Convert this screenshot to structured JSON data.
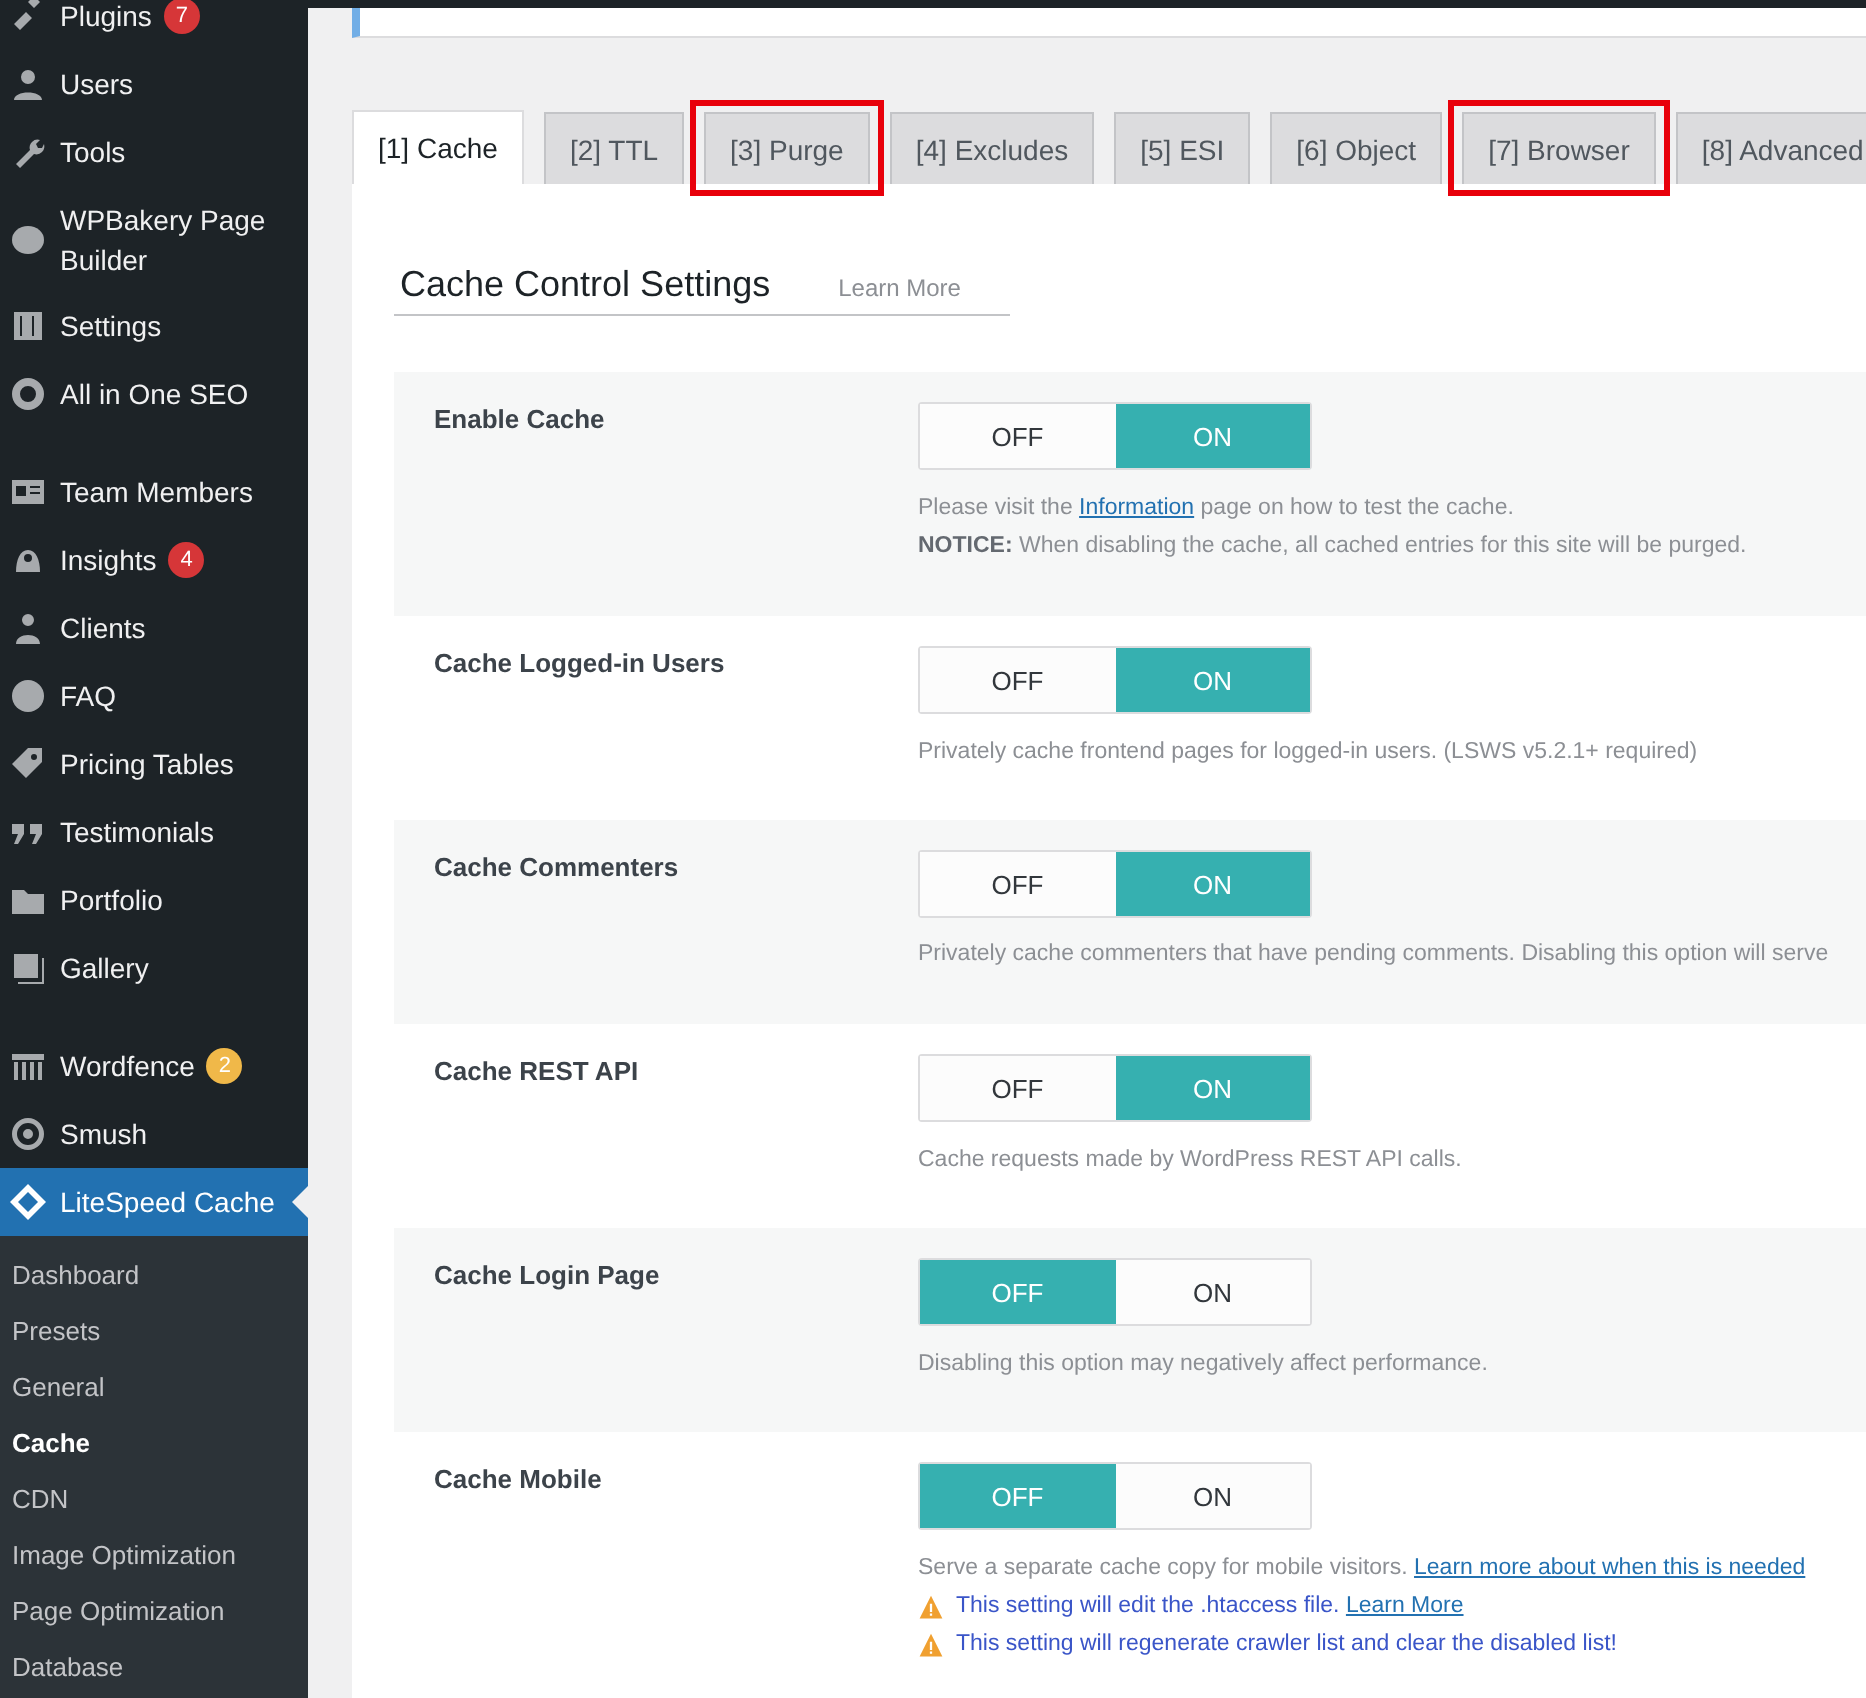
{
  "sidebar": {
    "items": [
      {
        "label": "Plugins",
        "badge": "7",
        "color": "#d63638",
        "gap_before": false
      },
      {
        "label": "Users",
        "gap_before": false
      },
      {
        "label": "Tools",
        "gap_before": false
      },
      {
        "label": "WPBakery Page Builder",
        "gap_before": false
      },
      {
        "label": "Settings",
        "gap_before": false
      },
      {
        "label": "All in One SEO",
        "gap_before": false
      },
      {
        "label": "Team Members",
        "gap_before": true
      },
      {
        "label": "Insights",
        "badge": "4",
        "color": "#d63638",
        "gap_before": false
      },
      {
        "label": "Clients",
        "gap_before": false
      },
      {
        "label": "FAQ",
        "gap_before": false
      },
      {
        "label": "Pricing Tables",
        "gap_before": false
      },
      {
        "label": "Testimonials",
        "gap_before": false
      },
      {
        "label": "Portfolio",
        "gap_before": false
      },
      {
        "label": "Gallery",
        "gap_before": false
      },
      {
        "label": "Wordfence",
        "badge": "2",
        "color": "#f0b849",
        "gap_before": true
      },
      {
        "label": "Smush",
        "gap_before": false
      }
    ],
    "active": {
      "label": "LiteSpeed Cache"
    },
    "submenu": [
      {
        "label": "Dashboard",
        "selected": false
      },
      {
        "label": "Presets",
        "selected": false
      },
      {
        "label": "General",
        "selected": false
      },
      {
        "label": "Cache",
        "selected": true
      },
      {
        "label": "CDN",
        "selected": false
      },
      {
        "label": "Image Optimization",
        "selected": false
      },
      {
        "label": "Page Optimization",
        "selected": false
      },
      {
        "label": "Database",
        "selected": false
      }
    ]
  },
  "tabs": [
    {
      "label": "[1] Cache",
      "selected": true,
      "highlighted": false
    },
    {
      "label": "[2] TTL",
      "selected": false,
      "highlighted": false
    },
    {
      "label": "[3] Purge",
      "selected": false,
      "highlighted": true
    },
    {
      "label": "[4] Excludes",
      "selected": false,
      "highlighted": false
    },
    {
      "label": "[5] ESI",
      "selected": false,
      "highlighted": false
    },
    {
      "label": "[6] Object",
      "selected": false,
      "highlighted": false
    },
    {
      "label": "[7] Browser",
      "selected": false,
      "highlighted": true
    },
    {
      "label": "[8] Advanced",
      "selected": false,
      "highlighted": false
    }
  ],
  "section": {
    "title": "Cache Control Settings",
    "learn_more": "Learn More"
  },
  "settings": [
    {
      "label": "Enable Cache",
      "on": true,
      "off_label": "OFF",
      "on_label": "ON",
      "lines": [
        {
          "kind": "note",
          "parts": [
            {
              "kind": "text",
              "text": "Please visit the "
            },
            {
              "kind": "link",
              "text": "Information"
            },
            {
              "kind": "text",
              "text": " page on how to test the cache."
            }
          ]
        },
        {
          "kind": "note",
          "parts": [
            {
              "kind": "text",
              "text": "**NOTICE:** When disabling the cache, all cached entries for this site will be purged."
            }
          ]
        }
      ]
    },
    {
      "label": "Cache Logged-in Users",
      "on": true,
      "off_label": "OFF",
      "on_label": "ON",
      "lines": [
        {
          "kind": "note",
          "parts": [
            {
              "kind": "text",
              "text": "Privately cache frontend pages for logged-in users. (LSWS v5.2.1+ required)"
            }
          ]
        }
      ]
    },
    {
      "label": "Cache Commenters",
      "on": true,
      "off_label": "OFF",
      "on_label": "ON",
      "lines": [
        {
          "kind": "note",
          "parts": [
            {
              "kind": "text",
              "text": "Privately cache commenters that have pending comments. Disabling this option will serve"
            }
          ]
        }
      ]
    },
    {
      "label": "Cache REST API",
      "on": true,
      "off_label": "OFF",
      "on_label": "ON",
      "lines": [
        {
          "kind": "note",
          "parts": [
            {
              "kind": "text",
              "text": "Cache requests made by WordPress REST API calls."
            }
          ]
        }
      ]
    },
    {
      "label": "Cache Login Page",
      "on": false,
      "off_label": "OFF",
      "on_label": "ON",
      "lines": [
        {
          "kind": "note",
          "parts": [
            {
              "kind": "text",
              "text": "Disabling this option may negatively affect performance."
            }
          ]
        }
      ]
    },
    {
      "label": "Cache Mobile",
      "on": false,
      "off_label": "OFF",
      "on_label": "ON",
      "lines": [
        {
          "kind": "note",
          "parts": [
            {
              "kind": "text",
              "text": "Serve a separate cache copy for mobile visitors. "
            },
            {
              "kind": "link",
              "text": "Learn more about when this is needed"
            }
          ]
        },
        {
          "kind": "warning",
          "parts": [
            {
              "kind": "text",
              "text": "This setting will edit the .htaccess file. "
            },
            {
              "kind": "link",
              "text": "Learn More"
            }
          ]
        },
        {
          "kind": "warning",
          "parts": [
            {
              "kind": "text",
              "text": "This setting will regenerate crawler list and clear the disabled list!"
            }
          ]
        }
      ]
    }
  ]
}
